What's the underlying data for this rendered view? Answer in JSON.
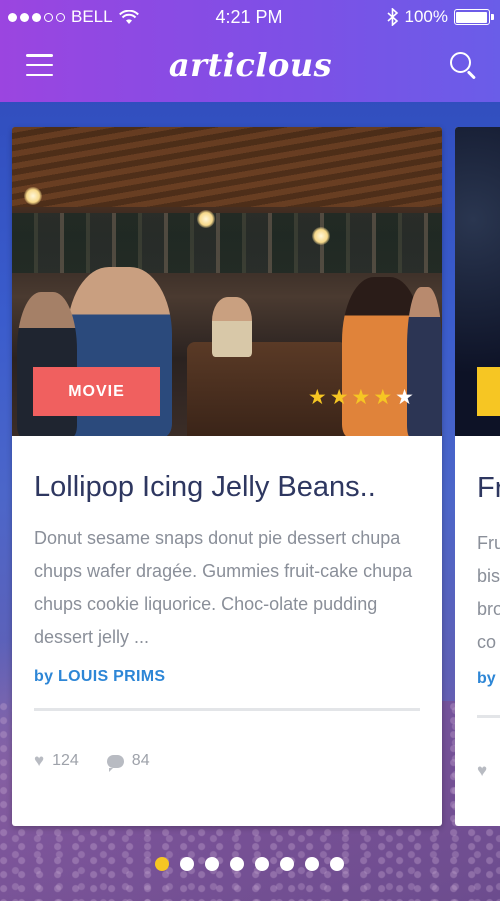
{
  "status_bar": {
    "carrier": "BELL",
    "time": "4:21 PM",
    "battery": "100%",
    "signal_bars": 3,
    "signal_total": 5
  },
  "header": {
    "logo": "articlous",
    "menu_icon": "hamburger-menu-icon",
    "search_icon": "search-icon",
    "gradient": [
      "#9b45e0",
      "#6a5de8"
    ]
  },
  "cards": [
    {
      "category": "MOVIE",
      "category_color": "#f0605f",
      "rating": 4,
      "rating_max": 5,
      "title": "Lollipop Icing Jelly Beans..",
      "excerpt": "Donut sesame snaps donut pie dessert chupa chups wafer dragée. Gummies fruit-cake chupa chups cookie liquorice. Choc-olate pudding dessert jelly ...",
      "author_prefix": "by",
      "author": "LOUIS PRIMS",
      "likes": "124",
      "comments": "84"
    },
    {
      "title_partial": "Fr",
      "excerpt_lines": [
        "Fru",
        "bis",
        "bro",
        "co"
      ],
      "author_prefix": "by",
      "category_color": "#f6c623"
    }
  ],
  "pager": {
    "total": 8,
    "active": 0,
    "active_color": "#f6c623"
  }
}
